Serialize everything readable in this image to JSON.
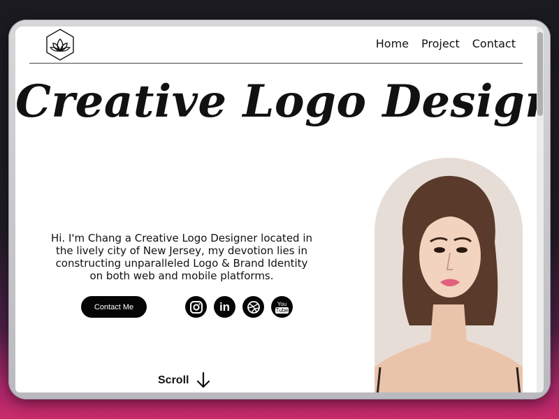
{
  "nav": {
    "logo_icon": "lotus-hexagon-icon",
    "links": [
      "Home",
      "Project",
      "Contact"
    ]
  },
  "hero": {
    "title": "Creative Logo Designer",
    "intro": "Hi. I'm Chang a Creative Logo Designer located in the lively city of New Jersey, my devotion lies in constructing unparalleled Logo & Brand Identity on both web and mobile platforms.",
    "contact_label": "Contact Me",
    "socials": [
      "instagram-icon",
      "linkedin-icon",
      "dribbble-icon",
      "youtube-icon"
    ],
    "youtube_text_1": "You",
    "youtube_text_2": "Tube",
    "linkedin_text": "in",
    "scroll_label": "Scroll"
  },
  "colors": {
    "background_dark": "#1b1a20",
    "accent_gradient_bottom": "#c92a6a",
    "button": "#050505",
    "text": "#111111"
  }
}
